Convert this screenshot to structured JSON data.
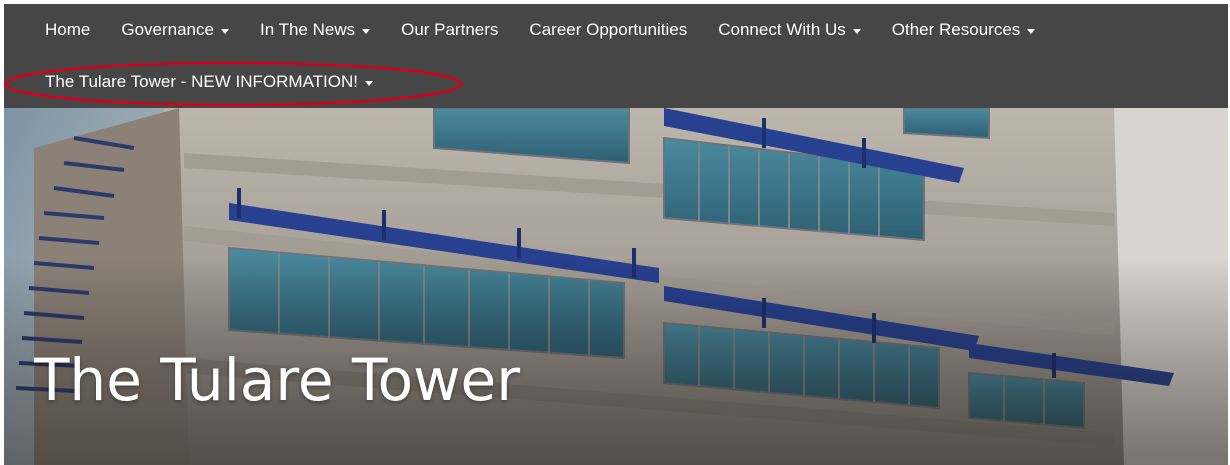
{
  "nav": {
    "items": [
      {
        "label": "Home",
        "dropdown": false
      },
      {
        "label": "Governance",
        "dropdown": true
      },
      {
        "label": "In The News",
        "dropdown": true
      },
      {
        "label": "Our Partners",
        "dropdown": false
      },
      {
        "label": "Career Opportunities",
        "dropdown": false
      },
      {
        "label": "Connect With Us",
        "dropdown": true
      },
      {
        "label": "Other Resources",
        "dropdown": true
      }
    ],
    "second_row": [
      {
        "label": "The Tulare Tower - NEW INFORMATION!",
        "dropdown": true
      }
    ],
    "background": "#464646",
    "highlight_color": "#d9001b"
  },
  "hero": {
    "title": "The Tulare Tower",
    "image": "building-facade-photo"
  }
}
